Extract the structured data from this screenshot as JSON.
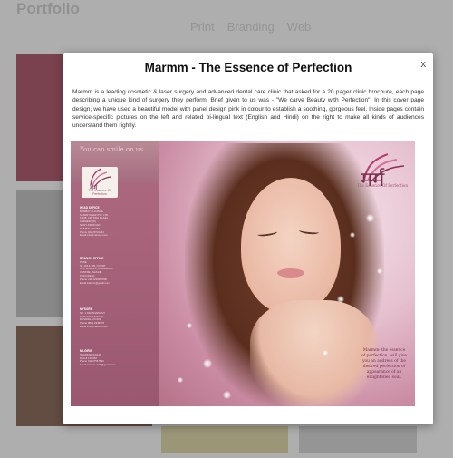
{
  "background": {
    "title": "Portfolio",
    "filters": [
      "Print",
      "Branding",
      "Web"
    ]
  },
  "modal": {
    "title": "Marmm - The Essence of Perfection",
    "close_label": "x",
    "description": "Marmm is a leading cosmetic & laser surgery and advanced dental care clinic that asked for a 20 pager clinic brochure, each page describing a unique kind of surgery they perform. Brief given to us was - \"We carve Beauty with Perfection\". In this cover page design, we have used a beautiful model with panel design pink in colour to establish a soothing, gorgeous feel. Inside pages contain service-specific pictures on the left and related bi-lingual text (English and Hindi) on the right to make all kinds of audiences understand them rightly."
  },
  "brochure": {
    "tagline": "You can smile on us",
    "logo_mark": "मर्म",
    "logo_sub": "The Essence Of Perfection",
    "caption": "Marmm- the essence of perfection, will give you an address of the desired perfection of appearance of an enlightened soul.",
    "address_blocks": [
      {
        "head": "HEAD OFFICE",
        "lines": [
          "BOMBAY ALLIANCE",
          "STARRYDEEP PVT. LTD.",
          "F-108, CRYSTAL PLAZA",
          "ANDHERI (W)",
          "NEW LINK ROAD",
          "MUMBAI 400 053",
          "Phone 022 26731234",
          "Email info@marmm.com"
        ]
      },
      {
        "head": "BRANCH OFFICE",
        "lines": [
          "PUNE",
          "SF 104 & 105, COURT",
          "OPP. EUROPA, KOREGAON",
          "CENTRE - NASHIK",
          "PINCODE 41",
          "Phone +91 1234567890",
          "Email marmm@gmail.com"
        ]
      },
      {
        "head": "MYSORE",
        "lines": [
          "NO. 1 DEVANAPATHY",
          "RAMASWAMI ROAD",
          "MYSORE-570 001",
          "Phone 0821-2345678",
          "Email info@marmm.com"
        ]
      },
      {
        "head": "NILGIRIS",
        "lines": [
          "SHANKAR NAGAR",
          "DELHI 110 052",
          "Phone 011-27567890",
          "Email marmm.delhi@gmail.com"
        ]
      }
    ]
  },
  "colors": {
    "panel_pink": "#a96479",
    "brand_maroon": "#7a2f4f"
  }
}
